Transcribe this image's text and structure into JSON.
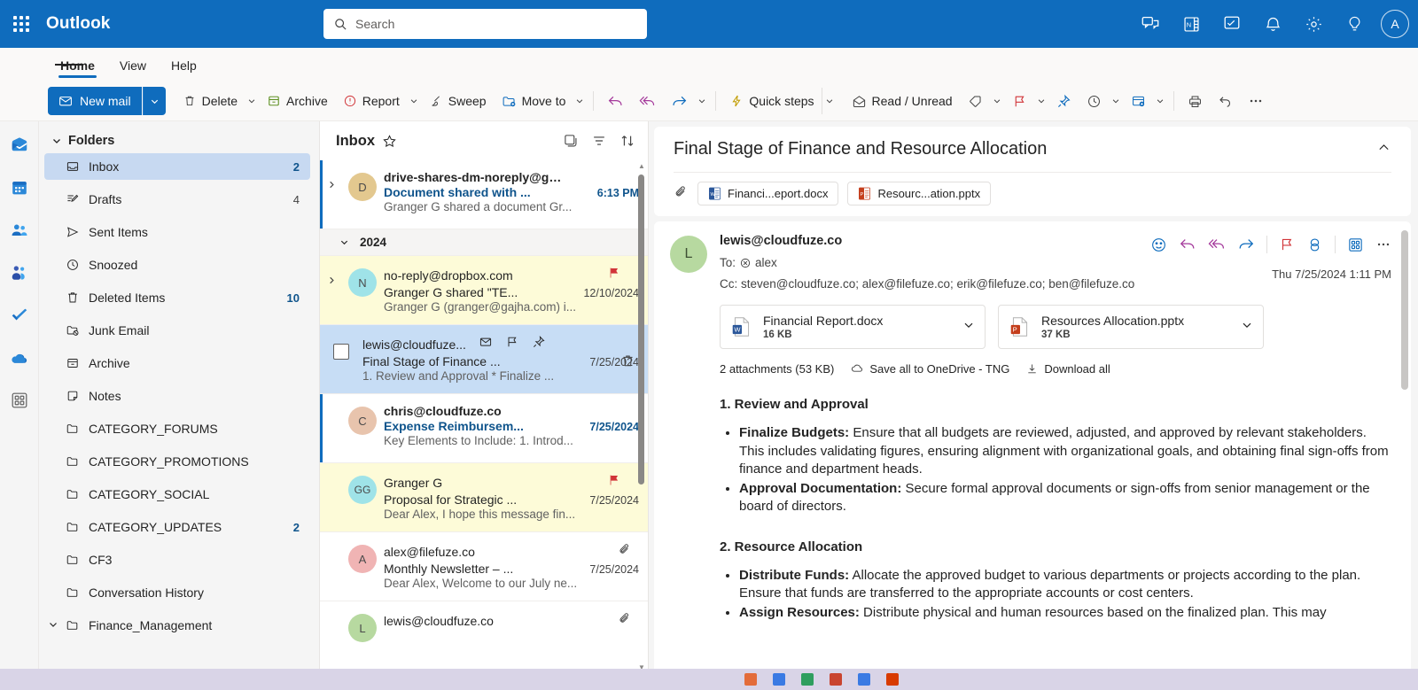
{
  "app": {
    "name": "Outlook",
    "accent": "#0f6cbd",
    "avatar_initial": "A"
  },
  "search": {
    "placeholder": "Search",
    "value": ""
  },
  "topbar_icons": [
    {
      "name": "teams-chat-icon",
      "label": "Teams chat"
    },
    {
      "name": "onenote-icon",
      "label": "OneNote"
    },
    {
      "name": "todo-icon",
      "label": "To Do"
    },
    {
      "name": "notifications-bell-icon",
      "label": "Notifications"
    },
    {
      "name": "settings-gear-icon",
      "label": "Settings"
    },
    {
      "name": "tips-lightbulb-icon",
      "label": "Tips"
    }
  ],
  "ribbon": {
    "tabs": [
      {
        "label": "Home",
        "active": true
      },
      {
        "label": "View",
        "active": false
      },
      {
        "label": "Help",
        "active": false
      }
    ]
  },
  "toolbar": {
    "new_mail": "New mail",
    "delete": "Delete",
    "archive": "Archive",
    "report": "Report",
    "sweep": "Sweep",
    "move_to": "Move to",
    "quick_steps": "Quick steps",
    "read_unread": "Read / Unread",
    "reply": "Reply",
    "reply_all": "Reply all",
    "forward": "Forward",
    "tag": "Tag",
    "flag": "Flag",
    "pin": "Pin",
    "snooze": "Snooze",
    "rules": "Rules",
    "print": "Print",
    "undo": "Undo",
    "more": "More options"
  },
  "rail": [
    {
      "name": "mail-icon",
      "label": "Mail"
    },
    {
      "name": "calendar-icon",
      "label": "Calendar"
    },
    {
      "name": "people-icon",
      "label": "People"
    },
    {
      "name": "teams-icon",
      "label": "Teams"
    },
    {
      "name": "todo-check-icon",
      "label": "To Do"
    },
    {
      "name": "onedrive-cloud-icon",
      "label": "OneDrive"
    },
    {
      "name": "apps-icon",
      "label": "More apps"
    }
  ],
  "sidebar": {
    "header": "Folders",
    "items": [
      {
        "label": "Inbox",
        "count": "2",
        "selected": true,
        "icon": "inbox-icon"
      },
      {
        "label": "Drafts",
        "count": "4",
        "selected": false,
        "icon": "drafts-icon"
      },
      {
        "label": "Sent Items",
        "count": "",
        "selected": false,
        "icon": "sent-icon"
      },
      {
        "label": "Snoozed",
        "count": "",
        "selected": false,
        "icon": "clock-icon"
      },
      {
        "label": "Deleted Items",
        "count": "10",
        "selected": false,
        "icon": "trash-icon"
      },
      {
        "label": "Junk Email",
        "count": "",
        "selected": false,
        "icon": "junk-icon"
      },
      {
        "label": "Archive",
        "count": "",
        "selected": false,
        "icon": "archive-icon"
      },
      {
        "label": "Notes",
        "count": "",
        "selected": false,
        "icon": "notes-icon"
      },
      {
        "label": "CATEGORY_FORUMS",
        "count": "",
        "selected": false,
        "icon": "folder-icon"
      },
      {
        "label": "CATEGORY_PROMOTIONS",
        "count": "",
        "selected": false,
        "icon": "folder-icon"
      },
      {
        "label": "CATEGORY_SOCIAL",
        "count": "",
        "selected": false,
        "icon": "folder-icon"
      },
      {
        "label": "CATEGORY_UPDATES",
        "count": "2",
        "selected": false,
        "icon": "folder-icon"
      },
      {
        "label": "CF3",
        "count": "",
        "selected": false,
        "icon": "folder-icon"
      },
      {
        "label": "Conversation History",
        "count": "",
        "selected": false,
        "icon": "folder-icon"
      },
      {
        "label": "Finance_Management",
        "count": "",
        "selected": false,
        "icon": "folder-icon",
        "chevron": true
      }
    ]
  },
  "message_list": {
    "title": "Inbox",
    "date_group": "2024",
    "rows": [
      {
        "sender": "drive-shares-dm-noreply@googl...",
        "subject": "Document shared with ...",
        "preview": "Granger G shared a document Gr...",
        "date": "6:13 PM",
        "avatar": "D",
        "avatar_color": "#e3c88f",
        "state": "unread",
        "flagged": false
      },
      {
        "sender": "no-reply@dropbox.com",
        "subject": "Granger G shared \"TE...",
        "preview": "Granger G (granger@gajha.com) i...",
        "date": "12/10/2024",
        "avatar": "N",
        "avatar_color": "#9fe3e8",
        "state": "flagged-yellow",
        "flagged": true
      },
      {
        "sender": "lewis@cloudfuze...",
        "subject": "Final Stage of Finance ...",
        "preview": "1. Review and Approval * Finalize ...",
        "date": "7/25/2024",
        "avatar": "L",
        "avatar_color": "#b7d9a0",
        "state": "selected",
        "flagged": false
      },
      {
        "sender": "chris@cloudfuze.co",
        "subject": "Expense Reimbursem...",
        "preview": "Key Elements to Include: 1. Introd...",
        "date": "7/25/2024",
        "avatar": "C",
        "avatar_color": "#e8c4ad",
        "state": "unread",
        "flagged": false
      },
      {
        "sender": "Granger G",
        "subject": "Proposal for Strategic ...",
        "preview": "Dear Alex, I hope this message fin...",
        "date": "7/25/2024",
        "avatar": "GG",
        "avatar_color": "#9fe3e8",
        "state": "flagged-yellow",
        "flagged": true
      },
      {
        "sender": "alex@filefuze.co",
        "subject": "Monthly Newsletter – ...",
        "preview": "Dear Alex, Welcome to our July ne...",
        "date": "7/25/2024",
        "avatar": "A",
        "avatar_color": "#f0b4b4",
        "state": "read",
        "flagged": false,
        "attachment": true
      },
      {
        "sender": "lewis@cloudfuze.co",
        "subject": "",
        "preview": "",
        "date": "",
        "avatar": "L",
        "avatar_color": "#b7d9a0",
        "state": "read",
        "flagged": false,
        "attachment": true
      }
    ]
  },
  "reading_pane": {
    "subject": "Final Stage of Finance and Resource Allocation",
    "attachment_chips": [
      {
        "label": "Financi...eport.docx",
        "type": "word"
      },
      {
        "label": "Resourc...ation.pptx",
        "type": "powerpoint"
      }
    ],
    "from": "lewis@cloudfuze.co",
    "avatar_initial": "L",
    "to_label": "To:",
    "to": "alex",
    "cc_label": "Cc:",
    "cc": "steven@cloudfuze.co;  alex@filefuze.co;  erik@filefuze.co;  ben@filefuze.co",
    "timestamp": "Thu 7/25/2024 1:11 PM",
    "header_icons": [
      {
        "name": "emoji-reaction-icon"
      },
      {
        "name": "reply-icon"
      },
      {
        "name": "reply-all-icon"
      },
      {
        "name": "forward-icon"
      },
      {
        "name": "flag-icon"
      },
      {
        "name": "loop-components-icon"
      },
      {
        "name": "apps-grid-icon"
      },
      {
        "name": "more-actions-icon"
      }
    ],
    "attachments": [
      {
        "name": "Financial Report.docx",
        "size": "16 KB",
        "type": "word"
      },
      {
        "name": "Resources Allocation.pptx",
        "size": "37 KB",
        "type": "powerpoint"
      }
    ],
    "attachment_summary": "2 attachments (53 KB)",
    "save_all_label": "Save all to OneDrive - TNG",
    "download_all_label": "Download all",
    "body": {
      "sections": [
        {
          "heading": "1. Review and Approval",
          "bullets": [
            {
              "term": "Finalize Budgets:",
              "text": " Ensure that all budgets are reviewed, adjusted, and approved by relevant stakeholders. This includes validating figures, ensuring alignment with organizational goals, and obtaining final sign-offs from finance and department heads."
            },
            {
              "term": "Approval Documentation:",
              "text": " Secure formal approval documents or sign-offs from senior management or the board of directors."
            }
          ]
        },
        {
          "heading": "2. Resource Allocation",
          "bullets": [
            {
              "term": "Distribute Funds:",
              "text": " Allocate the approved budget to various departments or projects according to the plan. Ensure that funds are transferred to the appropriate accounts or cost centers."
            },
            {
              "term": "Assign Resources:",
              "text": " Distribute physical and human resources based on the finalized plan. This may"
            }
          ]
        }
      ]
    }
  }
}
